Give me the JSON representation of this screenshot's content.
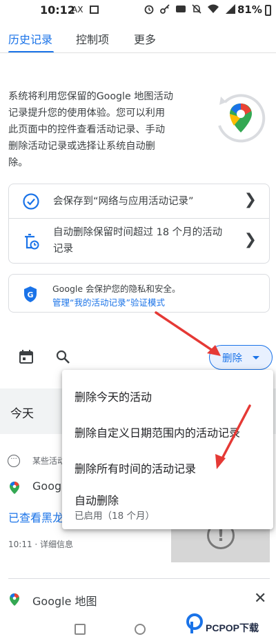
{
  "status_bar": {
    "time": "10:12",
    "ax": "AX",
    "battery": "81%",
    "net": "4G"
  },
  "tabs": [
    {
      "label": "历史记录",
      "active": true
    },
    {
      "label": "控制项",
      "active": false
    },
    {
      "label": "更多",
      "active": false
    }
  ],
  "intro": {
    "lines": [
      "系统将利用您保留的Google 地图活动",
      "记录提升您的使用体验。您可以利用",
      "此页面中的控件查看活动记录、手动",
      "删除活动记录或选择让系统自动删",
      "除。"
    ]
  },
  "settings_card": {
    "row1": "会保存到“网络与应用活动记录”",
    "row2_line1": "自动删除保留时间超过 18 个月的活动",
    "row2_line2": "记录"
  },
  "privacy_card": {
    "text": "Google 会保护您的隐私和安全。",
    "link": "管理“我的活动记录”验证模式"
  },
  "toolbar": {
    "delete_label": "删除"
  },
  "today_label": "今天",
  "activity": {
    "some_activity": "某些活动",
    "app1": "Goog",
    "viewed": "已查看黑龙",
    "meta": "10:11 · 详细信息",
    "app2": "Google 地图"
  },
  "delete_menu": {
    "item1": "删除今天的活动",
    "item2": "删除自定义日期范围内的活动记录",
    "item3": "删除所有时间的活动记录",
    "item4_title": "自动删除",
    "item4_sub": "已启用（18 个月）"
  },
  "watermark": {
    "text": "PCPOP下载"
  },
  "colors": {
    "accent": "#1a73e8",
    "annotation_red": "#e53935"
  }
}
